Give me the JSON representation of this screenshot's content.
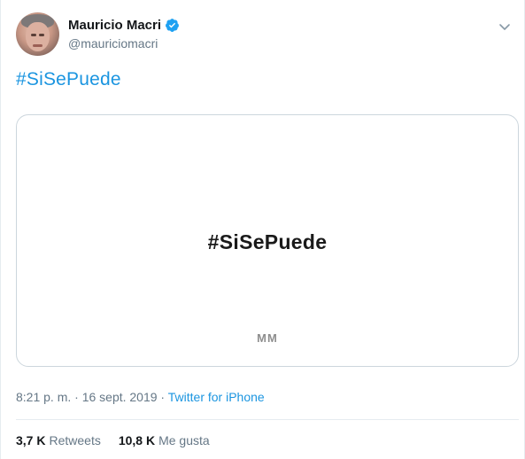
{
  "user": {
    "display_name": "Mauricio Macri",
    "screen_name": "@mauriciomacri",
    "verified": true
  },
  "tweet": {
    "text": "#SiSePuede",
    "timestamp": "8:21 p. m. · 16 sept. 2019",
    "separator": " · ",
    "source": "Twitter for iPhone"
  },
  "media": {
    "hashtag": "#SiSePuede",
    "logo_text": "MM"
  },
  "stats": {
    "retweets_count": "3,7 K",
    "retweets_label": "Retweets",
    "likes_count": "10,8 K",
    "likes_label": "Me gusta"
  },
  "icons": {
    "verified": "verified-badge-icon",
    "caret": "chevron-down-icon"
  },
  "colors": {
    "accent": "#1b95e0",
    "verified": "#1da1f2",
    "secondary_text": "#657786",
    "border": "#ccd6dd"
  }
}
